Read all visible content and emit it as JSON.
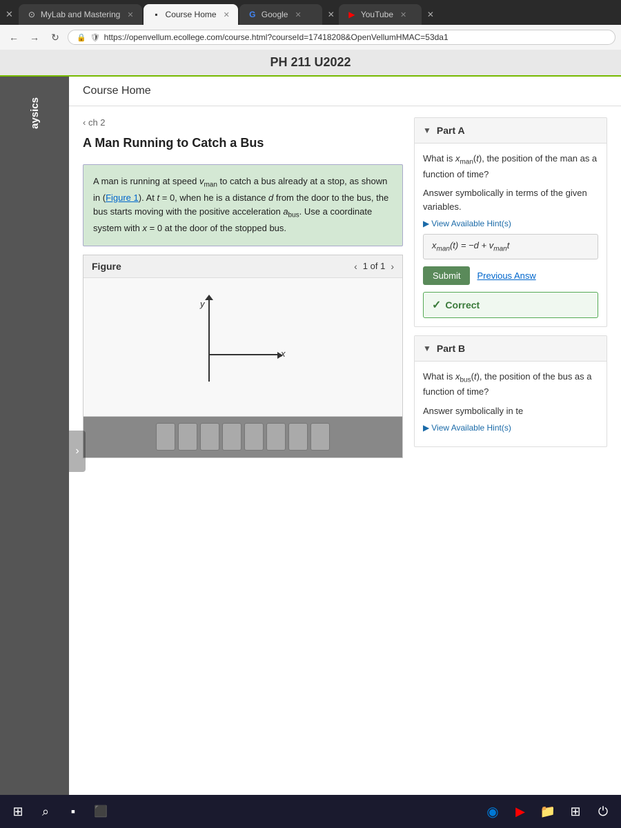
{
  "browser": {
    "tabs": [
      {
        "label": "MyLab and Mastering",
        "active": false,
        "icon": "⊙"
      },
      {
        "label": "Course Home",
        "active": true,
        "icon": "▪"
      },
      {
        "label": "Google",
        "active": false,
        "icon": "G"
      },
      {
        "label": "YouTube",
        "active": false,
        "icon": "▶"
      }
    ],
    "url": "https://openvellum.ecollege.com/course.html?courseId=17418208&OpenVellumHMAC=53da1",
    "lock_icon": "🔒"
  },
  "page": {
    "title": "PH 211 U2022",
    "course_home_label": "Course Home"
  },
  "sidebar": {
    "label": "aysics"
  },
  "problem": {
    "chapter_link": "‹ ch 2",
    "title": "A Man Running to Catch a Bus",
    "description": "A man is running at speed vₙₐₙ to catch a bus already at a stop, as shown in (Figure 1). At t = 0, when he is a distance d from the door to the bus, the bus starts moving with the positive acceleration aₙₙₙ. Use a coordinate system with x = 0 at the door of the stopped bus.",
    "figure_label": "Figure",
    "figure_page": "1 of 1"
  },
  "part_a": {
    "header": "Part A",
    "question": "What is xₘₐₙ(t), the position of the man as a function of time?",
    "question_suffix": "Answer symbolically in terms of the given variables.",
    "hint_label": "View Available Hint(s)",
    "answer": "xₘₐₙ(t) = −d + vₘₐₙt",
    "submit_label": "Submit",
    "prev_answer_label": "Previous Answ",
    "correct_label": "Correct",
    "check_symbol": "✓"
  },
  "part_b": {
    "header": "Part B",
    "question": "What is xₙₙₙ(t), the position of the bus as a function of time?",
    "question_suffix": "Answer symbolically in te",
    "hint_label": "View Available Hint(s)"
  },
  "taskbar": {
    "windows_icon": "⊞",
    "search_icon": "⊙",
    "file_icon": "▪",
    "camera_icon": "⬛",
    "edge_icon": "◉",
    "media_icon": "▶",
    "folder_icon": "📁",
    "grid_icon": "⊞",
    "power_icon": "⏻"
  }
}
